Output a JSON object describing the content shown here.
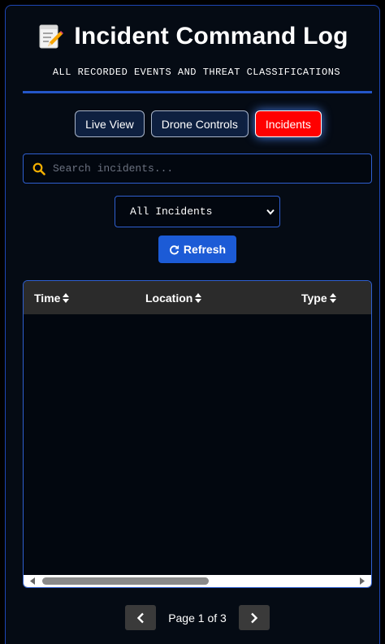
{
  "header": {
    "title": "Incident Command Log",
    "subtitle": "ALL RECORDED EVENTS AND THREAT CLASSIFICATIONS",
    "icon": "memo-pencil-icon"
  },
  "tabs": [
    {
      "label": "Live View",
      "active": false
    },
    {
      "label": "Drone Controls",
      "active": false
    },
    {
      "label": "Incidents",
      "active": true
    }
  ],
  "search": {
    "placeholder": "Search incidents...",
    "value": "",
    "icon": "search-icon"
  },
  "filter": {
    "selected": "All Incidents"
  },
  "refresh": {
    "label": "Refresh",
    "icon": "refresh-icon"
  },
  "table": {
    "columns": [
      {
        "label": "Time"
      },
      {
        "label": "Location"
      },
      {
        "label": "Type"
      }
    ],
    "rows": [],
    "horizontal_scroll_position": 0.0
  },
  "pagination": {
    "label": "Page 1 of 3",
    "current_page": 1,
    "total_pages": 3
  },
  "colors": {
    "accent_blue": "#2456c8",
    "active_tab": "#ff0000",
    "tab_background": "#0e2040",
    "search_icon": "#f5b000",
    "background": "#050b14"
  }
}
